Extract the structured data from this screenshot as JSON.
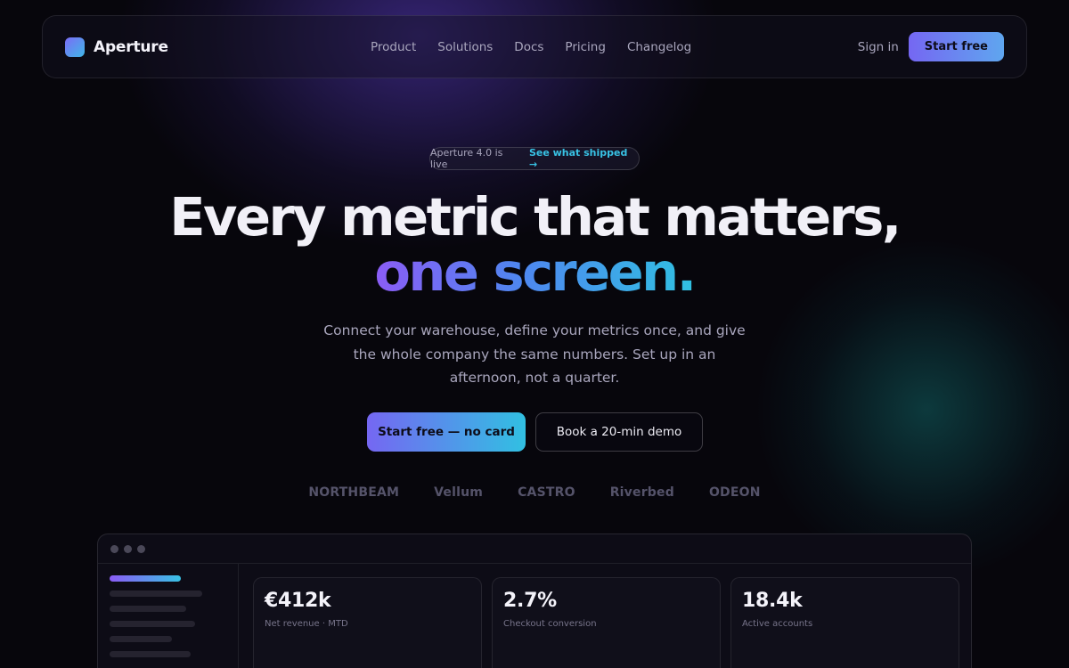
{
  "nav": {
    "brand": "Aperture",
    "links": [
      "Product",
      "Solutions",
      "Docs",
      "Pricing",
      "Changelog"
    ],
    "signin": "Sign in",
    "cta": "Start free"
  },
  "announcement": {
    "text": "Aperture 4.0 is live",
    "link": "See what shipped →"
  },
  "hero": {
    "headline_line1": "Every metric that matters,",
    "headline_line2": "one screen.",
    "subtext": "Connect your warehouse, define your metrics once, and give the whole company the same numbers. Set up in an afternoon, not a quarter.",
    "cta_primary": "Start free — no card",
    "cta_secondary": "Book a 20-min demo"
  },
  "logos": [
    "NORTHBEAM",
    "Vellum",
    "CASTRO",
    "Riverbed",
    "ODEON"
  ],
  "preview": {
    "stats": [
      {
        "value": "€412k",
        "label": "Net revenue · MTD"
      },
      {
        "value": "2.7%",
        "label": "Checkout conversion"
      },
      {
        "value": "18.4k",
        "label": "Active accounts"
      }
    ]
  },
  "colors": {
    "accent_start": "#7567f2",
    "accent_end": "#31c0e2",
    "background": "#07060c"
  }
}
